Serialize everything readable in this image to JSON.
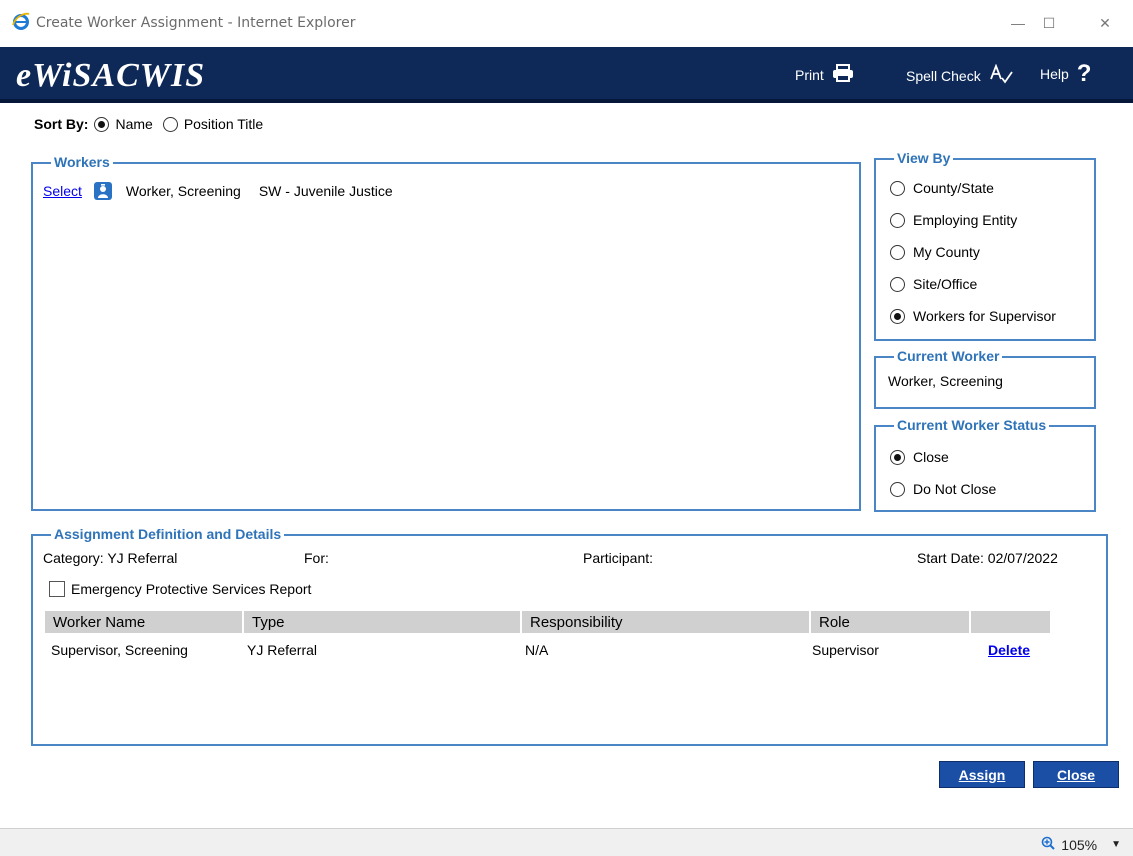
{
  "window": {
    "title": "Create Worker Assignment - Internet Explorer",
    "minimize": "—",
    "maximize": "☐",
    "close": "✕"
  },
  "header": {
    "brand": "eWiSACWIS",
    "print_label": "Print",
    "spell_label": "Spell Check",
    "help_label": "Help"
  },
  "sort": {
    "label": "Sort By:",
    "options": [
      "Name",
      "Position Title"
    ],
    "selected": "Name"
  },
  "workers": {
    "legend": "Workers",
    "rows": [
      {
        "select_label": "Select",
        "name": "Worker, Screening",
        "position": "SW - Juvenile Justice"
      }
    ]
  },
  "view_by": {
    "legend": "View By",
    "options": [
      "County/State",
      "Employing Entity",
      "My County",
      "Site/Office",
      "Workers for Supervisor"
    ],
    "selected": "Workers for Supervisor"
  },
  "current_worker": {
    "legend": "Current Worker",
    "value": "Worker, Screening"
  },
  "current_status": {
    "legend": "Current Worker Status",
    "options": [
      "Close",
      "Do Not Close"
    ],
    "selected": "Close"
  },
  "assignment": {
    "legend": "Assignment Definition and Details",
    "category": "Category:  YJ Referral",
    "for": "For:",
    "participant": "Participant:",
    "start_date": "Start Date:  02/07/2022",
    "eps_label": "Emergency Protective Services Report",
    "eps_checked": false,
    "columns": [
      "Worker Name",
      "Type",
      "Responsibility",
      "Role",
      ""
    ],
    "rows": [
      {
        "worker_name": "Supervisor, Screening",
        "type": "YJ Referral",
        "responsibility": "N/A",
        "role": "Supervisor",
        "action": "Delete"
      }
    ]
  },
  "buttons": {
    "assign": "Assign",
    "close": "Close"
  },
  "status_bar": {
    "zoom": "105%"
  },
  "colors": {
    "header_bg": "#0e2958",
    "accent": "#2f73b8",
    "button_bg": "#1b4fa5"
  }
}
